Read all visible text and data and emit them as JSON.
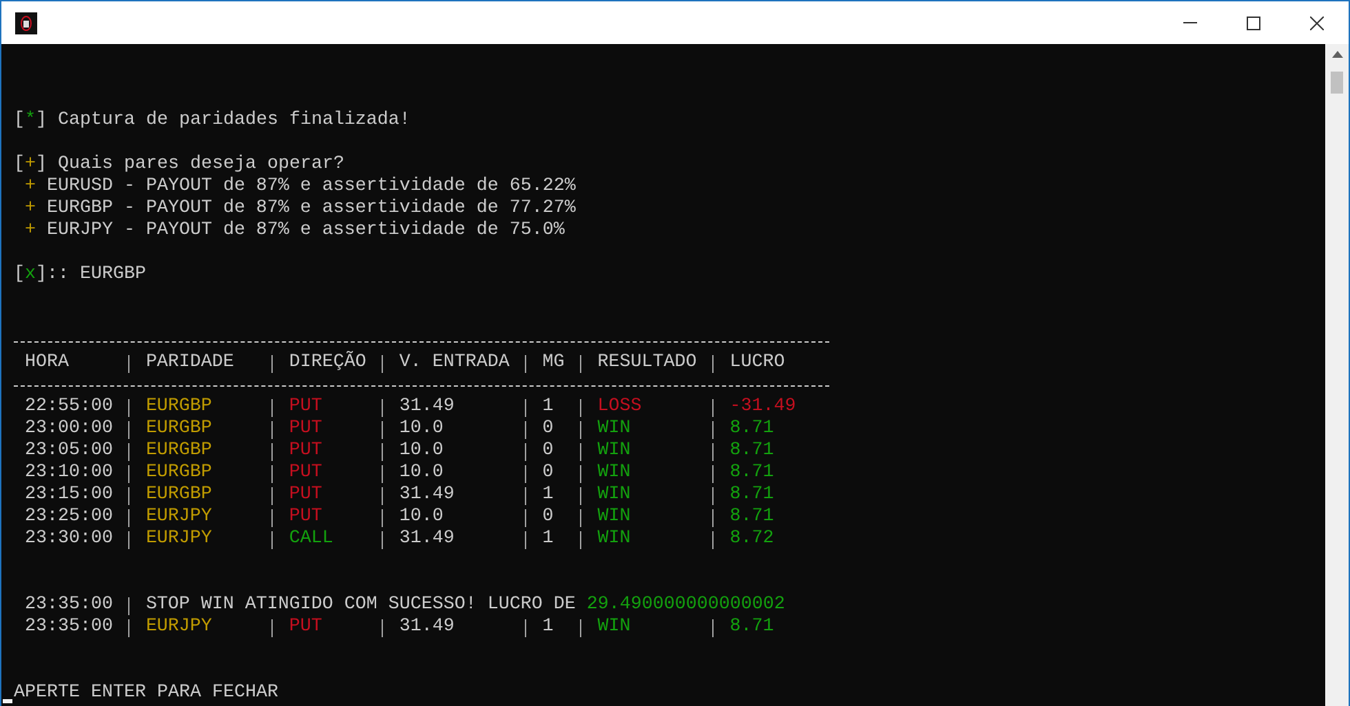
{
  "console": {
    "capture_notice": {
      "mark": {
        "open": "[",
        "symbol": "*",
        "close": "]",
        "color": "#13a10e"
      },
      "text": "Captura de paridades finalizada!"
    },
    "pair_question": {
      "mark": {
        "open": "[",
        "symbol": "+",
        "close": "]",
        "color": "#c19c00"
      },
      "text": "Quais pares deseja operar?"
    },
    "pairs": [
      {
        "bullet": "+",
        "text": "EURUSD - PAYOUT de 87% e assertividade de 65.22%"
      },
      {
        "bullet": "+",
        "text": "EURGBP - PAYOUT de 87% e assertividade de 77.27%"
      },
      {
        "bullet": "+",
        "text": "EURJPY - PAYOUT de 87% e assertividade de 75.0%"
      }
    ],
    "prompt": {
      "mark": {
        "open": "[",
        "symbol": "x",
        "close": "]",
        "color": "#13a10e"
      },
      "text": ":: EURGBP"
    },
    "table": {
      "columns": [
        "HORA",
        "PARIDADE",
        "DIREÇÃO",
        "V. ENTRADA",
        "MG",
        "RESULTADO",
        "LUCRO"
      ],
      "rows": [
        [
          {
            "text": "22:55:00"
          },
          {
            "text": "EURGBP",
            "color": "#c19c00"
          },
          {
            "text": "PUT",
            "color": "#c50f1f"
          },
          {
            "text": "31.49"
          },
          {
            "text": "1"
          },
          {
            "text": "LOSS",
            "color": "#c50f1f"
          },
          {
            "text": "-31.49",
            "color": "#c50f1f"
          }
        ],
        [
          {
            "text": "23:00:00"
          },
          {
            "text": "EURGBP",
            "color": "#c19c00"
          },
          {
            "text": "PUT",
            "color": "#c50f1f"
          },
          {
            "text": "10.0"
          },
          {
            "text": "0"
          },
          {
            "text": "WIN",
            "color": "#13a10e"
          },
          {
            "text": "8.71",
            "color": "#13a10e"
          }
        ],
        [
          {
            "text": "23:05:00"
          },
          {
            "text": "EURGBP",
            "color": "#c19c00"
          },
          {
            "text": "PUT",
            "color": "#c50f1f"
          },
          {
            "text": "10.0"
          },
          {
            "text": "0"
          },
          {
            "text": "WIN",
            "color": "#13a10e"
          },
          {
            "text": "8.71",
            "color": "#13a10e"
          }
        ],
        [
          {
            "text": "23:10:00"
          },
          {
            "text": "EURGBP",
            "color": "#c19c00"
          },
          {
            "text": "PUT",
            "color": "#c50f1f"
          },
          {
            "text": "10.0"
          },
          {
            "text": "0"
          },
          {
            "text": "WIN",
            "color": "#13a10e"
          },
          {
            "text": "8.71",
            "color": "#13a10e"
          }
        ],
        [
          {
            "text": "23:15:00"
          },
          {
            "text": "EURGBP",
            "color": "#c19c00"
          },
          {
            "text": "PUT",
            "color": "#c50f1f"
          },
          {
            "text": "31.49"
          },
          {
            "text": "1"
          },
          {
            "text": "WIN",
            "color": "#13a10e"
          },
          {
            "text": "8.71",
            "color": "#13a10e"
          }
        ],
        [
          {
            "text": "23:25:00"
          },
          {
            "text": "EURJPY",
            "color": "#c19c00"
          },
          {
            "text": "PUT",
            "color": "#c50f1f"
          },
          {
            "text": "10.0"
          },
          {
            "text": "0"
          },
          {
            "text": "WIN",
            "color": "#13a10e"
          },
          {
            "text": "8.71",
            "color": "#13a10e"
          }
        ],
        [
          {
            "text": "23:30:00"
          },
          {
            "text": "EURJPY",
            "color": "#c19c00"
          },
          {
            "text": "CALL",
            "color": "#13a10e"
          },
          {
            "text": "31.49"
          },
          {
            "text": "1"
          },
          {
            "text": "WIN",
            "color": "#13a10e"
          },
          {
            "text": "8.72",
            "color": "#13a10e"
          }
        ]
      ]
    },
    "stop_notice": {
      "time": "23:35:00",
      "message": "STOP WIN ATINGIDO COM SUCESSO! LUCRO DE",
      "value": "29.490000000000002"
    },
    "final_row": [
      {
        "text": "23:35:00"
      },
      {
        "text": "EURJPY",
        "color": "#c19c00"
      },
      {
        "text": "PUT",
        "color": "#c50f1f"
      },
      {
        "text": "31.49"
      },
      {
        "text": "1"
      },
      {
        "text": "WIN",
        "color": "#13a10e"
      },
      {
        "text": "8.71",
        "color": "#13a10e"
      }
    ],
    "footer": "APERTE ENTER PARA FECHAR"
  }
}
